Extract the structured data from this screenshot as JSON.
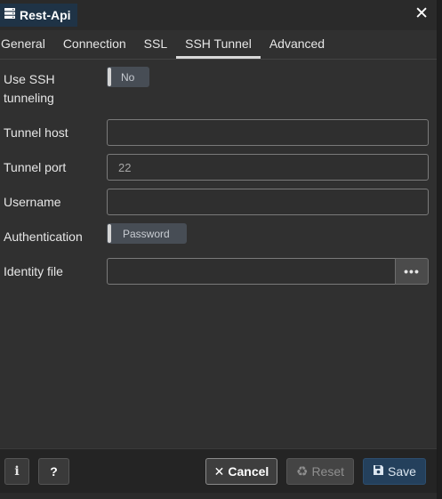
{
  "window": {
    "title": "Rest-Api",
    "icon": "server-icon",
    "close_icon": "close-icon"
  },
  "tabs": [
    {
      "label": "General",
      "active": false
    },
    {
      "label": "Connection",
      "active": false
    },
    {
      "label": "SSL",
      "active": false
    },
    {
      "label": "SSH Tunnel",
      "active": true
    },
    {
      "label": "Advanced",
      "active": false
    }
  ],
  "form": {
    "use_ssh": {
      "label": "Use SSH\ntunneling",
      "toggle_value": "No"
    },
    "tunnel_host": {
      "label": "Tunnel host",
      "value": ""
    },
    "tunnel_port": {
      "label": "Tunnel port",
      "value": "22"
    },
    "username": {
      "label": "Username",
      "value": ""
    },
    "authentication": {
      "label": "Authentication",
      "toggle_value": "Password"
    },
    "identity_file": {
      "label": "Identity file",
      "value": "",
      "browse_label": "•••"
    }
  },
  "footer": {
    "info_label": "i",
    "help_label": "?",
    "cancel_label": "Cancel",
    "reset_label": "Reset",
    "save_label": "Save"
  },
  "colors": {
    "dialog_bg": "#303030",
    "title_chip_bg": "#1f3346",
    "save_bg": "#24405c",
    "toggle_bg": "#474d55"
  }
}
